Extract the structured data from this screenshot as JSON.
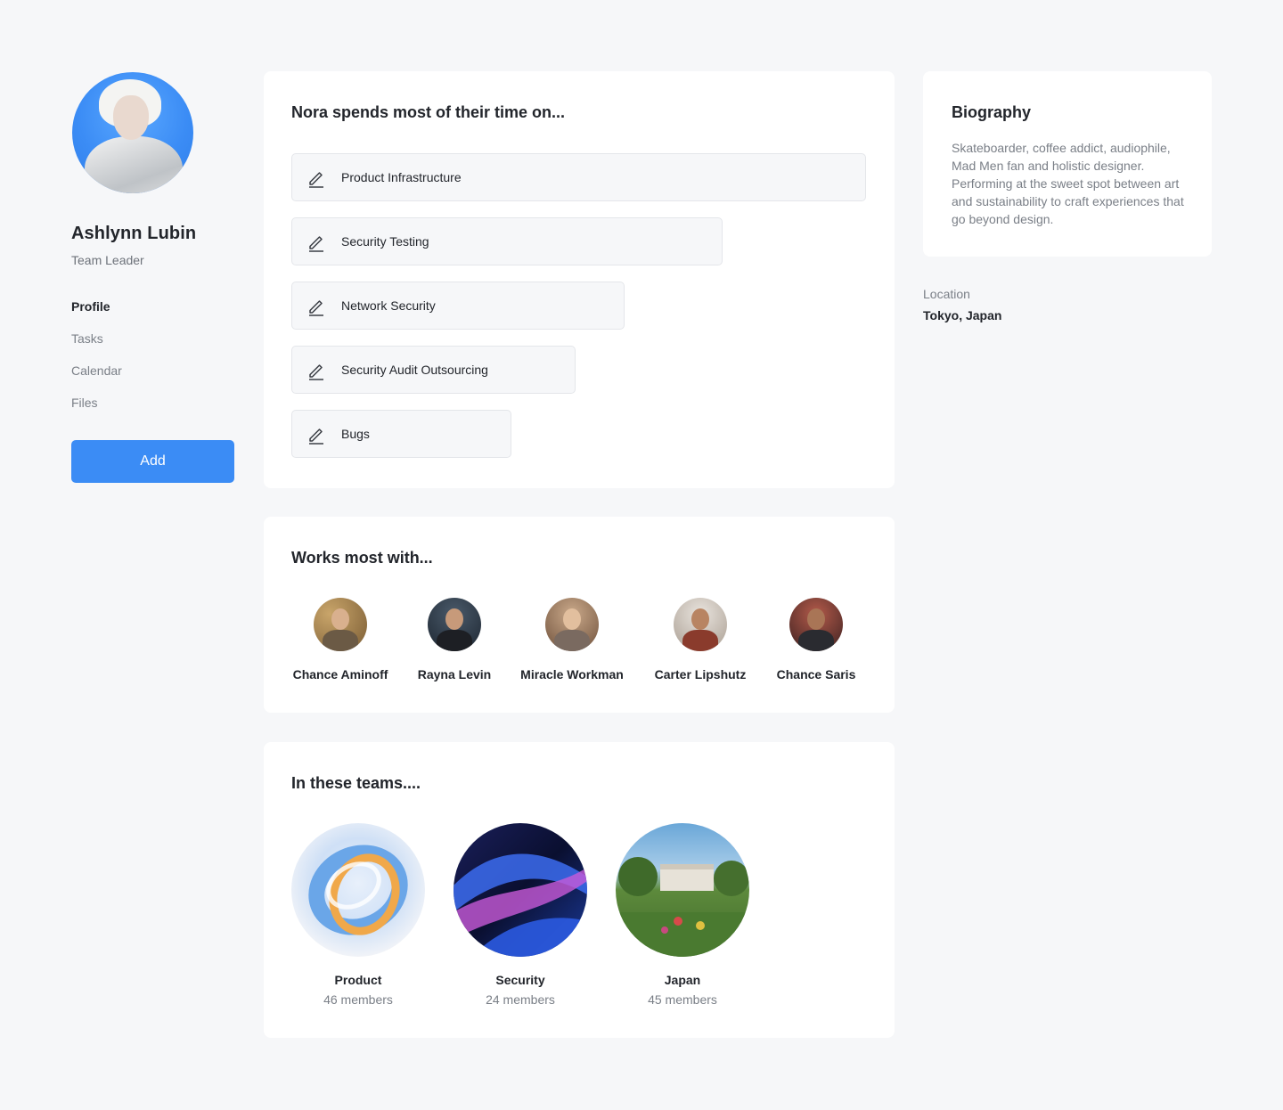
{
  "profile": {
    "name": "Ashlynn Lubin",
    "role": "Team Leader",
    "avatar_bg": "#3b8cf5"
  },
  "nav": {
    "items": [
      {
        "label": "Profile",
        "active": true
      },
      {
        "label": "Tasks",
        "active": false
      },
      {
        "label": "Calendar",
        "active": false
      },
      {
        "label": "Files",
        "active": false
      }
    ],
    "add_label": "Add"
  },
  "time": {
    "title": "Nora spends most of their time on...",
    "icon": "pencil-icon",
    "items": [
      {
        "label": "Product Infrastructure"
      },
      {
        "label": "Security Testing"
      },
      {
        "label": "Network Security"
      },
      {
        "label": "Security Audit Outsourcing"
      },
      {
        "label": "Bugs"
      }
    ]
  },
  "works": {
    "title": "Works most with...",
    "people": [
      {
        "name": "Chance Aminoff"
      },
      {
        "name": "Rayna Levin"
      },
      {
        "name": "Miracle Workman"
      },
      {
        "name": "Carter Lipshutz"
      },
      {
        "name": "Chance Saris"
      }
    ]
  },
  "teams": {
    "title": "In these teams....",
    "items": [
      {
        "name": "Product",
        "members": "46 members"
      },
      {
        "name": "Security",
        "members": "24 members"
      },
      {
        "name": "Japan",
        "members": "45 members"
      }
    ]
  },
  "biography": {
    "title": "Biography",
    "text": "Skateboarder, coffee addict, audiophile, Mad Men fan and holistic designer. Performing at the sweet spot between art and sustainability to craft experiences that go beyond design."
  },
  "location": {
    "label": "Location",
    "value": "Tokyo, Japan"
  },
  "colors": {
    "accent": "#3b8cf5",
    "background": "#f6f7f9",
    "card": "#ffffff"
  }
}
